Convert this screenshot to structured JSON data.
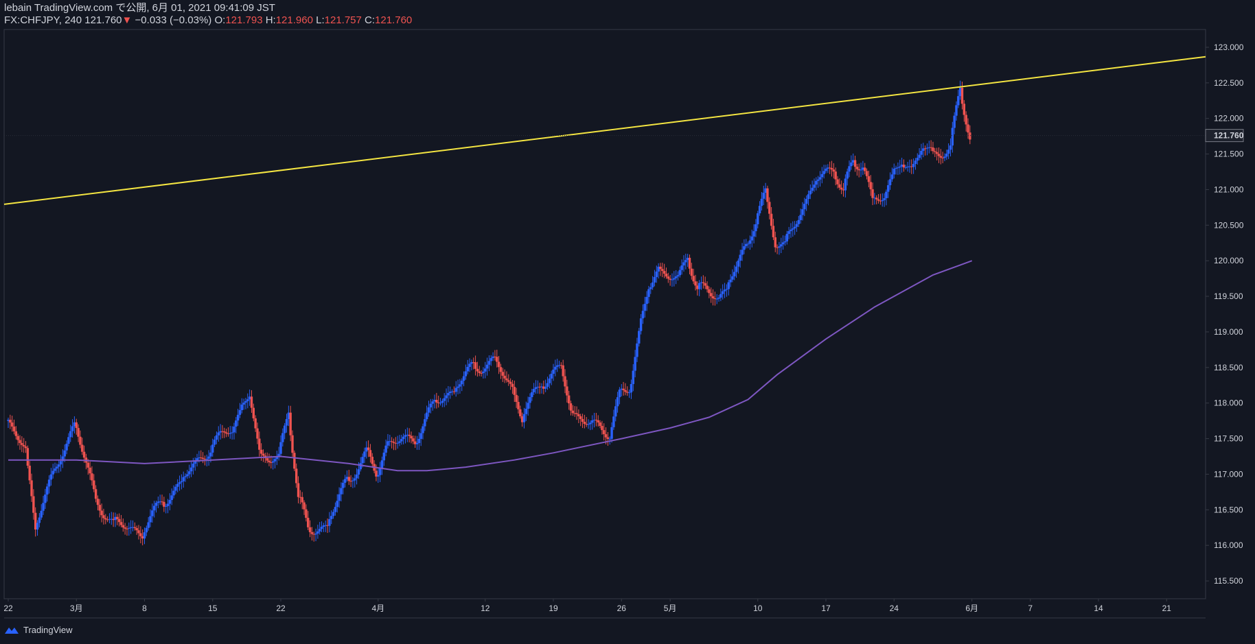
{
  "header": {
    "line1": "lebain TradingView.com で公開, 6月 01, 2021 09:41:09 JST",
    "symbol": "FX:CHFJPY, 240",
    "last": "121.760",
    "change_arrow": "▼",
    "change": "−0.033 (−0.03%)",
    "o_label": "O:",
    "o": "121.793",
    "h_label": "H:",
    "h": "121.960",
    "l_label": "L:",
    "l": "121.757",
    "c_label": "C:",
    "c": "121.760"
  },
  "branding": {
    "name": "TradingView"
  },
  "colors": {
    "background": "#131722",
    "up": "#2962ff",
    "down": "#ef5350",
    "trendline": "#f5e642",
    "ma": "#7e57c2",
    "text": "#d1d4dc",
    "axis": "#363a45"
  },
  "chart_data": {
    "type": "candlestick",
    "symbol": "FX:CHFJPY",
    "interval": "240",
    "ylim": [
      115.25,
      123.25
    ],
    "y_ticks": [
      "115.500",
      "116.000",
      "116.500",
      "117.000",
      "117.500",
      "118.000",
      "118.500",
      "119.000",
      "119.500",
      "120.000",
      "120.500",
      "121.000",
      "121.500",
      "122.000",
      "122.500",
      "123.000"
    ],
    "current_price_label": "121.760",
    "x_tick_labels": [
      "22",
      "3月",
      "8",
      "15",
      "22",
      "4月",
      "12",
      "19",
      "26",
      "5月",
      "10",
      "17",
      "24",
      "6月",
      "7",
      "14",
      "21"
    ],
    "close_path": [
      {
        "date": "2021-02-22",
        "price": 117.75
      },
      {
        "date": "2021-02-24",
        "price": 117.3
      },
      {
        "date": "2021-02-25",
        "price": 116.3
      },
      {
        "date": "2021-03-01",
        "price": 117.75
      },
      {
        "date": "2021-03-03",
        "price": 116.7
      },
      {
        "date": "2021-03-05",
        "price": 116.3
      },
      {
        "date": "2021-03-08",
        "price": 116.2
      },
      {
        "date": "2021-03-10",
        "price": 116.6
      },
      {
        "date": "2021-03-12",
        "price": 116.9
      },
      {
        "date": "2021-03-15",
        "price": 117.4
      },
      {
        "date": "2021-03-17",
        "price": 117.6
      },
      {
        "date": "2021-03-18",
        "price": 117.9
      },
      {
        "date": "2021-03-19",
        "price": 118.1
      },
      {
        "date": "2021-03-20",
        "price": 117.3
      },
      {
        "date": "2021-03-22",
        "price": 117.2
      },
      {
        "date": "2021-03-23",
        "price": 117.9
      },
      {
        "date": "2021-03-24",
        "price": 116.7
      },
      {
        "date": "2021-03-25",
        "price": 116.2
      },
      {
        "date": "2021-03-27",
        "price": 116.3
      },
      {
        "date": "2021-03-29",
        "price": 116.9
      },
      {
        "date": "2021-03-31",
        "price": 117.3
      },
      {
        "date": "2021-04-01",
        "price": 117.0
      },
      {
        "date": "2021-04-02",
        "price": 117.4
      },
      {
        "date": "2021-04-05",
        "price": 117.5
      },
      {
        "date": "2021-04-07",
        "price": 118.0
      },
      {
        "date": "2021-04-09",
        "price": 118.2
      },
      {
        "date": "2021-04-11",
        "price": 118.5
      },
      {
        "date": "2021-04-13",
        "price": 118.6
      },
      {
        "date": "2021-04-15",
        "price": 118.2
      },
      {
        "date": "2021-04-16",
        "price": 117.8
      },
      {
        "date": "2021-04-18",
        "price": 118.3
      },
      {
        "date": "2021-04-20",
        "price": 118.5
      },
      {
        "date": "2021-04-21",
        "price": 117.9
      },
      {
        "date": "2021-04-23",
        "price": 117.7
      },
      {
        "date": "2021-04-25",
        "price": 117.6
      },
      {
        "date": "2021-04-26",
        "price": 118.1
      },
      {
        "date": "2021-04-27",
        "price": 118.2
      },
      {
        "date": "2021-04-28",
        "price": 119.0
      },
      {
        "date": "2021-04-29",
        "price": 119.6
      },
      {
        "date": "2021-04-30",
        "price": 119.9
      },
      {
        "date": "2021-05-02",
        "price": 119.7
      },
      {
        "date": "2021-05-03",
        "price": 120.1
      },
      {
        "date": "2021-05-04",
        "price": 119.6
      },
      {
        "date": "2021-05-06",
        "price": 119.5
      },
      {
        "date": "2021-05-07",
        "price": 119.6
      },
      {
        "date": "2021-05-09",
        "price": 120.2
      },
      {
        "date": "2021-05-10",
        "price": 120.6
      },
      {
        "date": "2021-05-11",
        "price": 120.9
      },
      {
        "date": "2021-05-12",
        "price": 120.3
      },
      {
        "date": "2021-05-13",
        "price": 120.2
      },
      {
        "date": "2021-05-15",
        "price": 120.8
      },
      {
        "date": "2021-05-16",
        "price": 121.1
      },
      {
        "date": "2021-05-18",
        "price": 121.3
      },
      {
        "date": "2021-05-19",
        "price": 121.0
      },
      {
        "date": "2021-05-20",
        "price": 121.35
      },
      {
        "date": "2021-05-21",
        "price": 121.4
      },
      {
        "date": "2021-05-22",
        "price": 120.8
      },
      {
        "date": "2021-05-23",
        "price": 120.9
      },
      {
        "date": "2021-05-24",
        "price": 121.2
      },
      {
        "date": "2021-05-25",
        "price": 121.35
      },
      {
        "date": "2021-05-26",
        "price": 121.3
      },
      {
        "date": "2021-05-27",
        "price": 121.6
      },
      {
        "date": "2021-05-28",
        "price": 121.5
      },
      {
        "date": "2021-05-30",
        "price": 121.6
      },
      {
        "date": "2021-05-31",
        "price": 122.4
      },
      {
        "date": "2021-06-01",
        "price": 121.76
      }
    ],
    "trendline": [
      {
        "date": "2021-02-22",
        "price": 120.8
      },
      {
        "date": "2021-06-24",
        "price": 122.85
      }
    ],
    "moving_average": [
      {
        "date": "2021-02-22",
        "price": 117.2
      },
      {
        "date": "2021-03-01",
        "price": 117.2
      },
      {
        "date": "2021-03-08",
        "price": 117.15
      },
      {
        "date": "2021-03-15",
        "price": 117.2
      },
      {
        "date": "2021-03-22",
        "price": 117.25
      },
      {
        "date": "2021-03-29",
        "price": 117.15
      },
      {
        "date": "2021-04-03",
        "price": 117.05
      },
      {
        "date": "2021-04-06",
        "price": 117.05
      },
      {
        "date": "2021-04-10",
        "price": 117.1
      },
      {
        "date": "2021-04-15",
        "price": 117.2
      },
      {
        "date": "2021-04-19",
        "price": 117.3
      },
      {
        "date": "2021-04-26",
        "price": 117.5
      },
      {
        "date": "2021-05-01",
        "price": 117.65
      },
      {
        "date": "2021-05-05",
        "price": 117.8
      },
      {
        "date": "2021-05-09",
        "price": 118.05
      },
      {
        "date": "2021-05-12",
        "price": 118.4
      },
      {
        "date": "2021-05-17",
        "price": 118.9
      },
      {
        "date": "2021-05-22",
        "price": 119.35
      },
      {
        "date": "2021-05-28",
        "price": 119.8
      },
      {
        "date": "2021-06-01",
        "price": 120.0
      }
    ]
  }
}
